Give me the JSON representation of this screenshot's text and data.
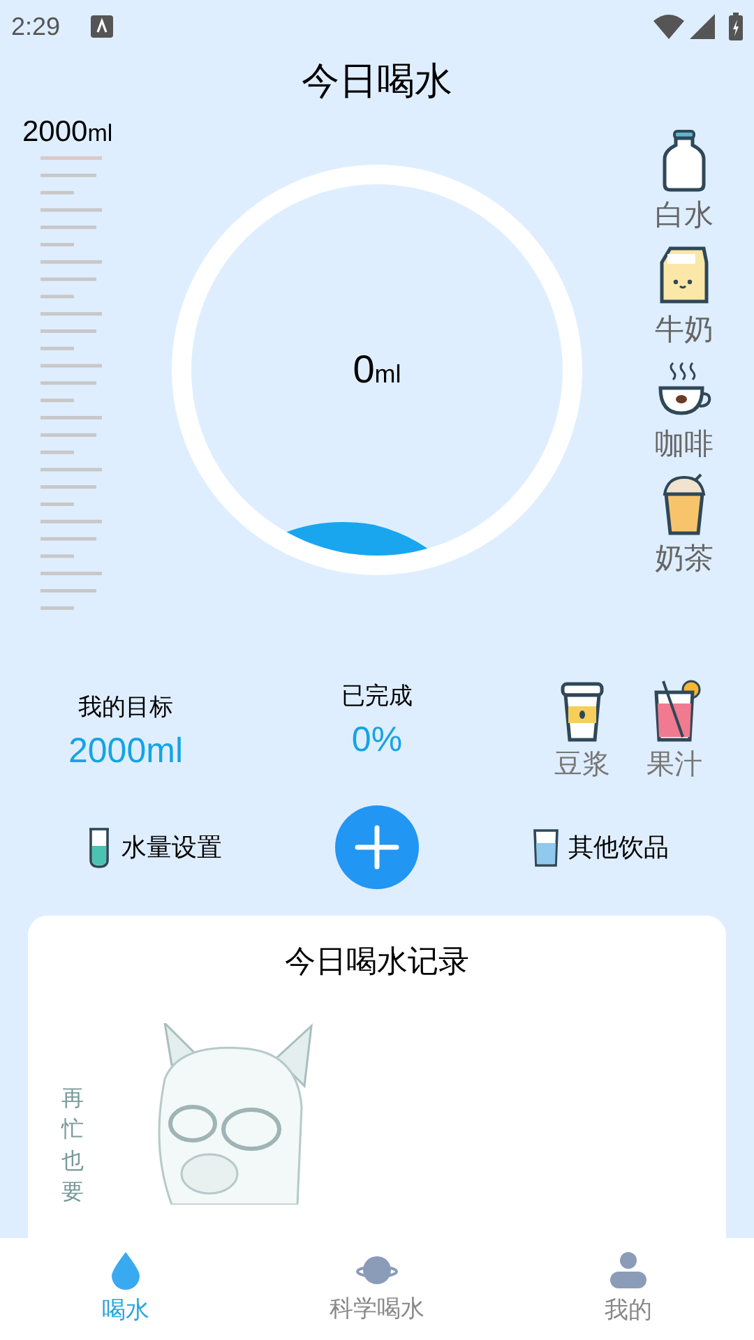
{
  "status_bar": {
    "time": "2:29"
  },
  "title": "今日喝水",
  "scale": {
    "max_label": "2000",
    "max_unit": "ml"
  },
  "gauge": {
    "amount": "0",
    "unit": "ml"
  },
  "drinks": [
    {
      "kind": "water",
      "label": "白水"
    },
    {
      "kind": "milk",
      "label": "牛奶"
    },
    {
      "kind": "coffee",
      "label": "咖啡"
    },
    {
      "kind": "milktea",
      "label": "奶茶"
    }
  ],
  "goal": {
    "label": "我的目标",
    "value": "2000ml"
  },
  "done": {
    "label": "已完成",
    "value": "0%"
  },
  "extra_drinks": [
    {
      "kind": "soymilk",
      "label": "豆浆"
    },
    {
      "kind": "juice",
      "label": "果汁"
    }
  ],
  "actions": [
    {
      "kind": "water_settings",
      "label": "水量设置"
    },
    {
      "kind": "other_drinks",
      "label": "其他饮品"
    }
  ],
  "record": {
    "title": "今日喝水记录",
    "slogan": "再忙也要"
  },
  "nav": [
    {
      "kind": "drop",
      "label": "喝水",
      "selected": true
    },
    {
      "kind": "planet",
      "label": "科学喝水",
      "selected": false
    },
    {
      "kind": "person",
      "label": "我的",
      "selected": false
    }
  ]
}
